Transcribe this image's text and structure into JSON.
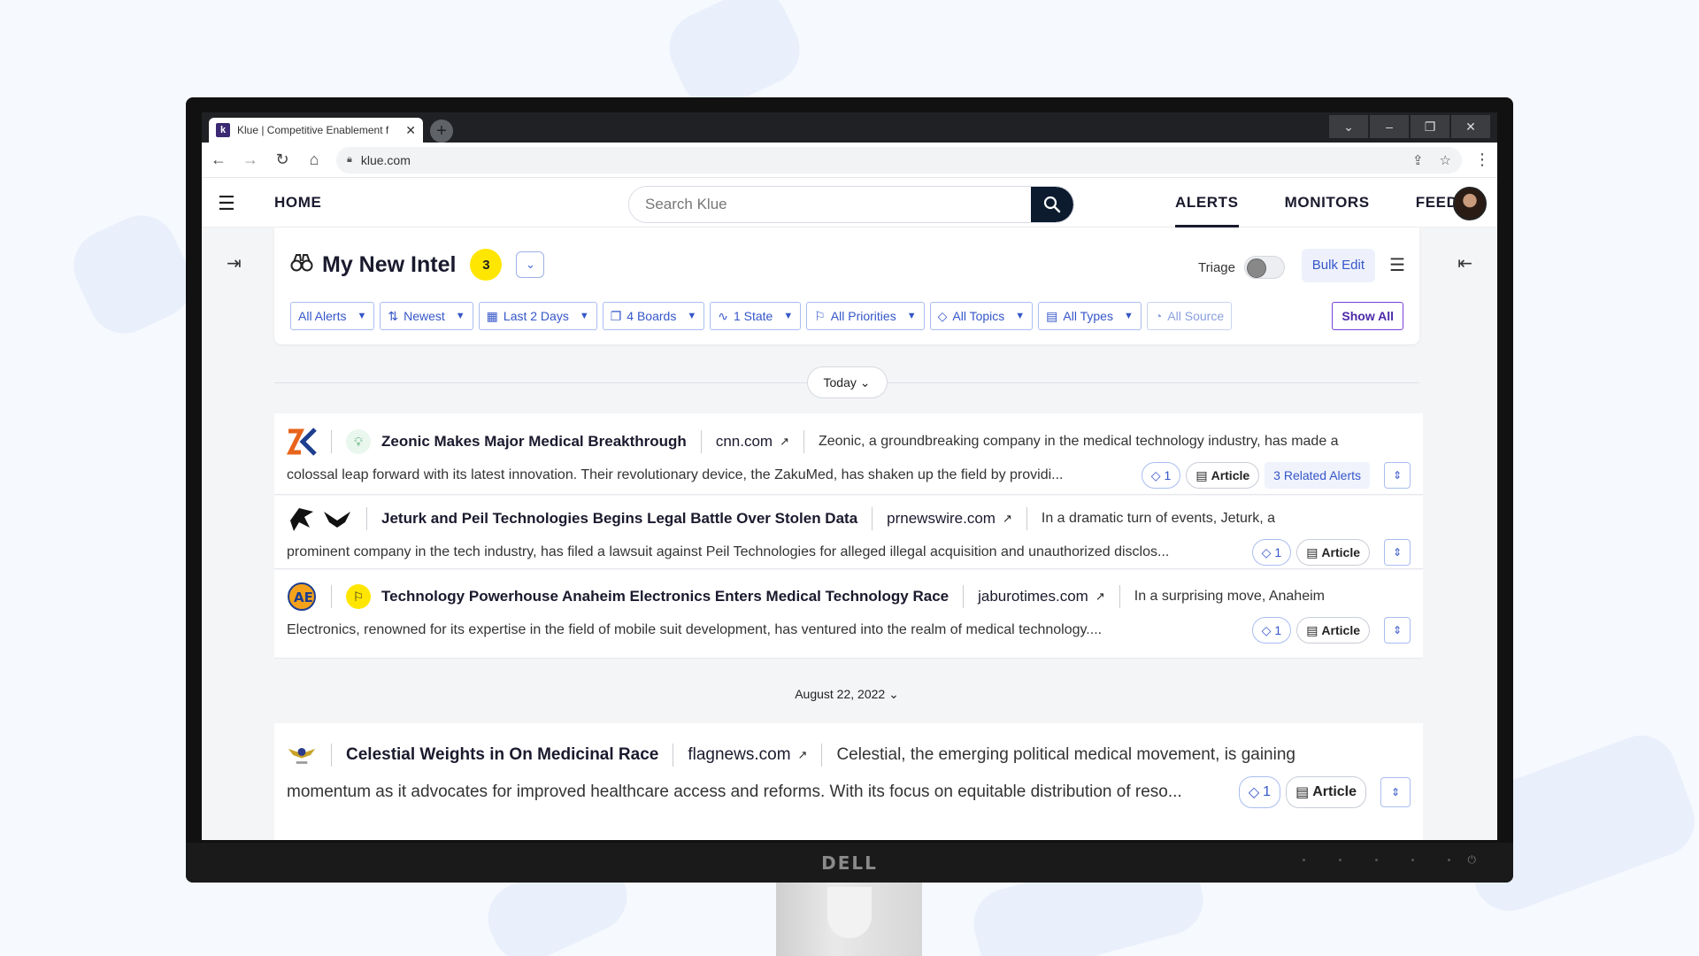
{
  "browser": {
    "tab_title": "Klue | Competitive Enablement f",
    "favicon_letter": "k",
    "url": "klue.com"
  },
  "header": {
    "home_label": "HOME",
    "search_placeholder": "Search Klue",
    "nav": [
      {
        "label": "ALERTS"
      },
      {
        "label": "MONITORS"
      },
      {
        "label": "FEED"
      }
    ]
  },
  "intel": {
    "title": "My New Intel",
    "count": "3",
    "triage_label": "Triage",
    "bulk_edit_label": "Bulk Edit",
    "show_all_label": "Show All",
    "filters": [
      {
        "label": "All Alerts"
      },
      {
        "label": "Newest"
      },
      {
        "label": "Last 2 Days"
      },
      {
        "label": "4 Boards"
      },
      {
        "label": "1 State"
      },
      {
        "label": "All Priorities"
      },
      {
        "label": "All Topics"
      },
      {
        "label": "All Types"
      },
      {
        "label": "All Source"
      }
    ]
  },
  "groups": [
    {
      "date_label": "Today"
    },
    {
      "date_label": "August 22, 2022"
    }
  ],
  "alerts": [
    {
      "title": "Zeonic Makes Major Medical Breakthrough",
      "source": "cnn.com",
      "snippet_start": "Zeonic, a groundbreaking company in the medical technology industry, has made a",
      "snippet": "colossal leap forward with its latest innovation. Their revolutionary device, the ZakuMed, has shaken up the field by providi...",
      "tag_count": "1",
      "type_label": "Article",
      "related_label": "3 Related Alerts"
    },
    {
      "title": "Jeturk and Peil Technologies Begins Legal Battle Over Stolen Data",
      "source": "prnewswire.com",
      "snippet_start": "In a dramatic turn of events, Jeturk, a",
      "snippet": "prominent company in the tech industry, has filed a lawsuit against Peil Technologies for alleged illegal acquisition and unauthorized disclos...",
      "tag_count": "1",
      "type_label": "Article"
    },
    {
      "title": "Technology Powerhouse Anaheim Electronics Enters Medical Technology Race",
      "source": "jaburotimes.com",
      "snippet_start": "In a surprising move, Anaheim",
      "snippet": "Electronics, renowned for its expertise in the field of mobile suit development, has ventured into the realm of medical technology....",
      "tag_count": "1",
      "type_label": "Article"
    },
    {
      "title": "Celestial Weights in On Medicinal Race",
      "source": "flagnews.com",
      "snippet_start": "Celestial, the emerging political medical movement, is gaining",
      "snippet": "momentum as it advocates for improved healthcare access  and reforms. With its focus on equitable distribution of  reso...",
      "tag_count": "1",
      "type_label": "Article"
    }
  ],
  "monitor_brand": "DELL"
}
